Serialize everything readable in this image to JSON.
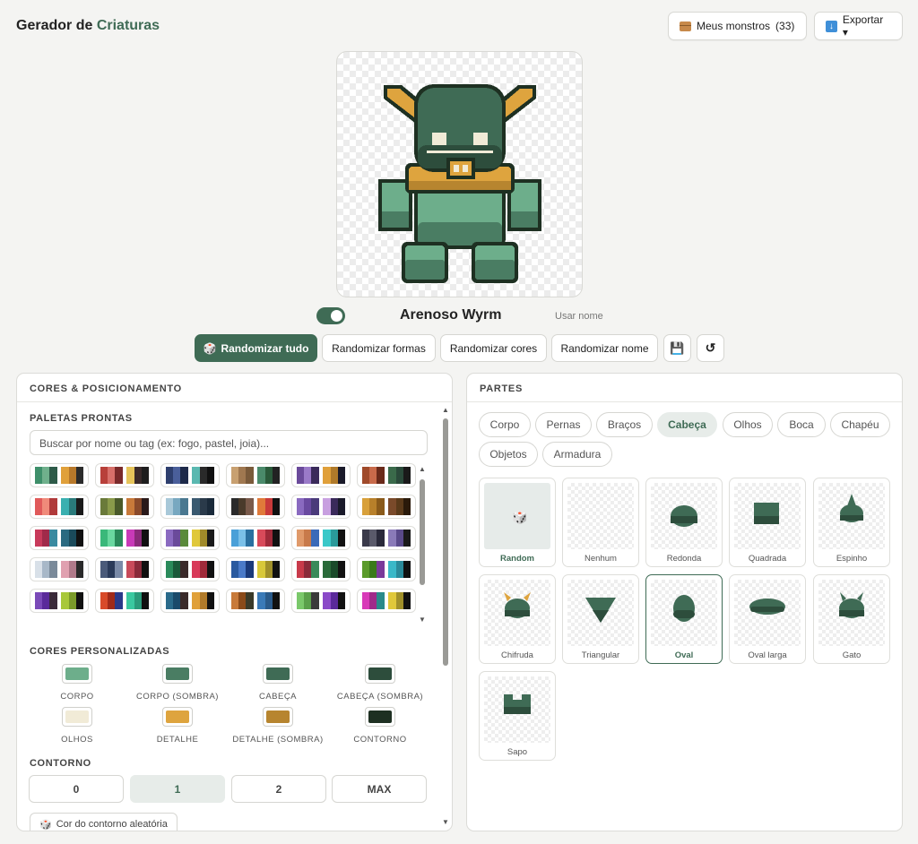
{
  "header": {
    "title_prefix": "Gerador de",
    "title_accent": "Criaturas",
    "my_monsters_label": "Meus monstros",
    "my_monsters_count": "(33)",
    "export_label": "Exportar ▾"
  },
  "creature": {
    "name": "Arenoso Wyrm",
    "use_name_label": "Usar nome",
    "use_name_toggle": true
  },
  "actions": {
    "randomize_all": "Randomizar tudo",
    "randomize_shapes": "Randomizar formas",
    "randomize_colors": "Randomizar cores",
    "randomize_name": "Randomizar nome",
    "save_icon": "💾",
    "reset_icon": "↺"
  },
  "left_panel": {
    "title": "CORES & POSICIONAMENTO",
    "palettes_title": "PALETAS PRONTAS",
    "search_placeholder": "Buscar por nome ou tag (ex: fogo, pastel, joia)...",
    "custom_colors_title": "CORES PERSONALIZADAS",
    "custom_colors": [
      {
        "label": "CORPO",
        "color": "#6dae8b"
      },
      {
        "label": "CORPO (SOMBRA)",
        "color": "#4a7d63"
      },
      {
        "label": "CABEÇA",
        "color": "#3f6b55"
      },
      {
        "label": "CABEÇA (SOMBRA)",
        "color": "#2d4d3c"
      },
      {
        "label": "OLHOS",
        "color": "#f1ebd7"
      },
      {
        "label": "DETALHE",
        "color": "#dea43e"
      },
      {
        "label": "DETALHE (SOMBRA)",
        "color": "#b7852f"
      },
      {
        "label": "CONTORNO",
        "color": "#1e3022"
      }
    ],
    "contour_title": "CONTORNO",
    "contour_options": [
      "0",
      "1",
      "2",
      "MAX"
    ],
    "contour_selected": "1",
    "random_contour_label": "Cor do contorno aleatória"
  },
  "right_panel": {
    "title": "PARTES",
    "categories": [
      "Corpo",
      "Pernas",
      "Braços",
      "Cabeça",
      "Olhos",
      "Boca",
      "Chapéu",
      "Objetos",
      "Armadura"
    ],
    "selected_category": "Cabeça",
    "parts": [
      "Random",
      "Nenhum",
      "Redonda",
      "Quadrada",
      "Espinho",
      "Chifruda",
      "Triangular",
      "Oval",
      "Oval larga",
      "Gato",
      "Sapo"
    ],
    "selected_part": "Oval"
  },
  "palettes": [
    [
      "#3e8f6a",
      "#6fb08c",
      "#2d5a48",
      "#ffffff",
      "#e0a03a",
      "#b7782a",
      "#2b2b2b"
    ],
    [
      "#b8403a",
      "#d8706a",
      "#7a2a2a",
      "#ffffff",
      "#e6c45a",
      "#3a2a2a",
      "#1e1e1e"
    ],
    [
      "#2e3f6e",
      "#4a5f9a",
      "#1e2a4a",
      "#ffffff",
      "#5ab8b0",
      "#2a2a2a",
      "#111111"
    ],
    [
      "#c8a070",
      "#a07850",
      "#7a5a3a",
      "#ffffff",
      "#4a8a6a",
      "#2a5a3a",
      "#222222"
    ],
    [
      "#6a4a9a",
      "#9a7ac8",
      "#3a2a5a",
      "#ffffff",
      "#e0a03a",
      "#b07a2a",
      "#1a1a2a"
    ],
    [
      "#a04a2a",
      "#c86a4a",
      "#6a2a1a",
      "#ffffff",
      "#3a6a4a",
      "#2a4a3a",
      "#1a1a1a"
    ],
    [
      "#e05a5a",
      "#f08a7a",
      "#b03a3a",
      "#ffffff",
      "#3ab0b0",
      "#2a7a7a",
      "#1a1a1a"
    ],
    [
      "#6a7a3a",
      "#8a9a4a",
      "#4a5a2a",
      "#ffffff",
      "#c87a3a",
      "#8a4a2a",
      "#2a1a1a"
    ],
    [
      "#a8c8d8",
      "#78a8c0",
      "#4a7890",
      "#ffffff",
      "#3a5a70",
      "#2a3a4a",
      "#1a2a3a"
    ],
    [
      "#2a2a2a",
      "#4a3a2a",
      "#7a5a4a",
      "#ffffff",
      "#e07a3a",
      "#c83a3a",
      "#111111"
    ],
    [
      "#8a6ac0",
      "#6a4aa0",
      "#4a3a7a",
      "#ffffff",
      "#c8a0e0",
      "#3a2a5a",
      "#1a1a2a"
    ],
    [
      "#d8a03a",
      "#b8802a",
      "#8a5a1a",
      "#ffffff",
      "#7a4a2a",
      "#5a3a1a",
      "#2a1a0a"
    ],
    [
      "#c83a5a",
      "#a02a4a",
      "#3a8aa0",
      "#ffffff",
      "#2a6a80",
      "#1a4a5a",
      "#111111"
    ],
    [
      "#3ab87a",
      "#6ad8a0",
      "#2a8a5a",
      "#ffffff",
      "#c83ab8",
      "#8a2a7a",
      "#111111"
    ],
    [
      "#8a6ac0",
      "#6a4a9a",
      "#5a8a3a",
      "#ffffff",
      "#e0c83a",
      "#a08a2a",
      "#1a1a1a"
    ],
    [
      "#4aa0d8",
      "#7ac0e8",
      "#2a70a0",
      "#ffffff",
      "#d84a5a",
      "#a02a3a",
      "#111111"
    ],
    [
      "#e09a6a",
      "#c87a4a",
      "#3a6ab8",
      "#ffffff",
      "#3ac8c8",
      "#2a9a9a",
      "#111111"
    ],
    [
      "#3a3a4a",
      "#5a5a6a",
      "#2a2a3a",
      "#ffffff",
      "#8a7ab8",
      "#5a4a8a",
      "#1a1a1a"
    ],
    [
      "#d8e0e8",
      "#a8b8c8",
      "#7a8a9a",
      "#ffffff",
      "#e0a0b0",
      "#b07a8a",
      "#2a2a2a"
    ],
    [
      "#4a5a7a",
      "#2a3a5a",
      "#7a8aa8",
      "#ffffff",
      "#c84a5a",
      "#8a2a3a",
      "#111111"
    ],
    [
      "#2a8a5a",
      "#1a5a3a",
      "#3a2a2a",
      "#ffffff",
      "#d83a5a",
      "#a02a3a",
      "#111111"
    ],
    [
      "#2a5aa0",
      "#4a7ac8",
      "#1a3a7a",
      "#ffffff",
      "#d8c83a",
      "#a0902a",
      "#111111"
    ],
    [
      "#c83a4a",
      "#8a2a3a",
      "#3a8a5a",
      "#ffffff",
      "#2a6a3a",
      "#1a4a2a",
      "#111111"
    ],
    [
      "#5a9a2a",
      "#3a7a1a",
      "#7a3a9a",
      "#ffffff",
      "#3ab8c8",
      "#2a8a9a",
      "#111111"
    ],
    [
      "#7a4ab8",
      "#5a2a9a",
      "#3a2a3a",
      "#ffffff",
      "#a8c83a",
      "#7a9a2a",
      "#111111"
    ],
    [
      "#d84a2a",
      "#a02a1a",
      "#2a3a8a",
      "#ffffff",
      "#3ac8a0",
      "#2a9a7a",
      "#111111"
    ],
    [
      "#2a6a8a",
      "#1a4a6a",
      "#3a2a2a",
      "#ffffff",
      "#e0a03a",
      "#b07a2a",
      "#111111"
    ],
    [
      "#c87a3a",
      "#8a4a1a",
      "#3a3a2a",
      "#ffffff",
      "#3a7ab8",
      "#2a5a8a",
      "#111111"
    ],
    [
      "#7ac86a",
      "#5aa04a",
      "#3a3a3a",
      "#ffffff",
      "#8a4ac8",
      "#5a2a9a",
      "#111111"
    ],
    [
      "#d83ab8",
      "#a02a8a",
      "#2a8a8a",
      "#ffffff",
      "#e0c83a",
      "#a0902a",
      "#111111"
    ]
  ]
}
